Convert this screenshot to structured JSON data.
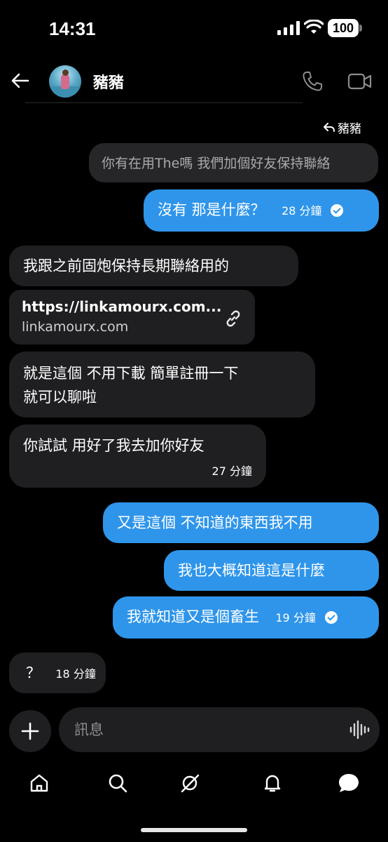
{
  "status": {
    "time": "14:31",
    "battery": "100"
  },
  "header": {
    "contact_name": "豬豬"
  },
  "reply_label": "豬豬",
  "messages": {
    "quoted": "你有在用The嗎 我們加個好友保持聯絡",
    "m1": {
      "text": "沒有 那是什麼？",
      "time": "28 分鐘"
    },
    "m2": "我跟之前固炮保持長期聯絡用的",
    "link": {
      "title": "https://linkamourx.com...",
      "domain": "linkamourx.com"
    },
    "m3_line1": "就是這個  不用下載  簡單註冊一下",
    "m3_line2": "就可以聊啦",
    "m4": {
      "text": "你試試 用好了我去加你好友",
      "time": "27 分鐘"
    },
    "m5": "又是這個 不知道的東西我不用",
    "m6": "我也大概知道這是什麼",
    "m7": {
      "text": "我就知道又是個畜生",
      "time": "19 分鐘"
    },
    "m8": {
      "text": "？",
      "time": "18 分鐘"
    }
  },
  "composer": {
    "placeholder": "訊息"
  },
  "tabs": [
    "home",
    "search",
    "grok",
    "notifications",
    "messages"
  ],
  "colors": {
    "outgoing": "#2f95ea",
    "incoming": "#1f1f22",
    "background": "#000000"
  }
}
